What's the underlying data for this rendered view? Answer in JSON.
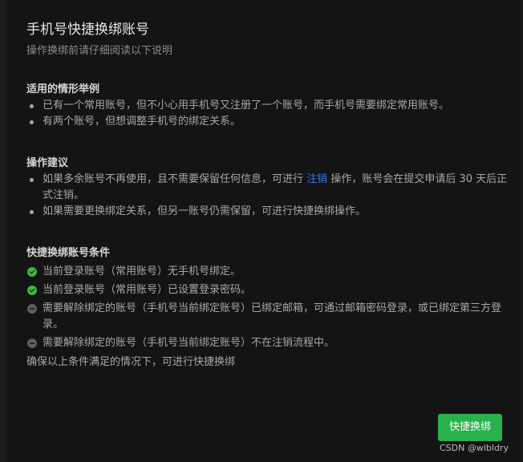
{
  "dialog": {
    "title": "手机号快捷换绑账号",
    "subtitle": "操作换绑前请仔细阅读以下说明"
  },
  "scenarios": {
    "heading": "适用的情形举例",
    "items": [
      "已有一个常用账号，但不小心用手机号又注册了一个账号，而手机号需要绑定常用账号。",
      "有两个账号，但想调整手机号的绑定关系。"
    ]
  },
  "suggestions": {
    "heading": "操作建议",
    "item1_before": "如果多余账号不再使用，且不需要保留任何信息，可进行",
    "item1_link": "注销",
    "item1_after": "操作，账号会在提交申请后 30 天后正式注销。",
    "item2": "如果需要更换绑定关系，但另一账号仍需保留，可进行快捷换绑操作。"
  },
  "conditions": {
    "heading": "快捷换绑账号条件",
    "items": [
      {
        "text": "当前登录账号（常用账号）无手机号绑定。",
        "status": "met"
      },
      {
        "text": "当前登录账号（常用账号）已设置登录密码。",
        "status": "met"
      },
      {
        "text": "需要解除绑定的账号（手机号当前绑定账号）已绑定邮箱，可通过邮箱密码登录，或已绑定第三方登录。",
        "status": "unknown"
      },
      {
        "text": "需要解除绑定的账号（手机号当前绑定账号）不在注销流程中。",
        "status": "unknown"
      }
    ],
    "footnote": "确保以上条件满足的情况下，可进行快捷换绑"
  },
  "actions": {
    "confirm_label": "快捷换绑"
  },
  "watermark": "CSDN @wlbldry",
  "colors": {
    "background": "#141414",
    "link": "#2f7bf0",
    "primary_button": "#28b14c",
    "status_met": "#3fb53f",
    "status_unknown": "#5e5e5e"
  }
}
